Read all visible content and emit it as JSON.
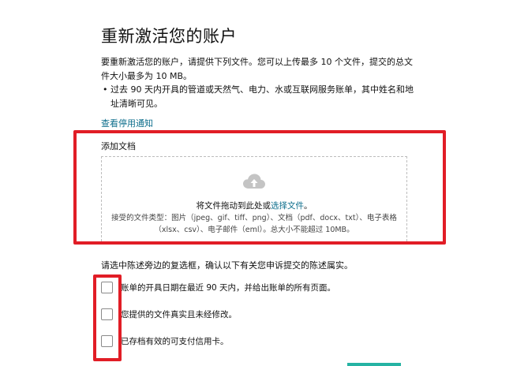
{
  "page": {
    "title": "重新激活您的账户",
    "intro": "要重新激活您的账户，请提供下列文件。您可以上传最多 10 个文件，提交的总文件大小最多为 10 MB。",
    "bullets": [
      "过去 90 天内开具的管道或天然气、电力、水或互联网服务账单，其中姓名和地址清晰可见。"
    ],
    "notice_link": "查看停用通知",
    "add_doc_label": "添加文档"
  },
  "dropzone": {
    "drag_text": "将文件拖动到此处或",
    "select_link": "选择文件",
    "period": "。",
    "file_types": "接受的文件类型：图片（jpeg、gif、tiff、png）、文档（pdf、docx、txt）、电子表格（xlsx、csv）、电子邮件（eml）。总大小不能超过 10MB。"
  },
  "confirm": {
    "text": "请选中陈述旁边的复选框，确认以下有关您申诉提交的陈述属实。",
    "items": [
      "账单的开具日期在最近 90 天内，并给出账单的所有页面。",
      "您提供的文件真实且未经修改。",
      "已存档有效的可支付信用卡。"
    ]
  },
  "colors": {
    "link": "#0d6e8c",
    "highlight_red": "#e11d26",
    "accent_teal": "#26b3a3",
    "cloud_icon": "#c4c4c4"
  }
}
